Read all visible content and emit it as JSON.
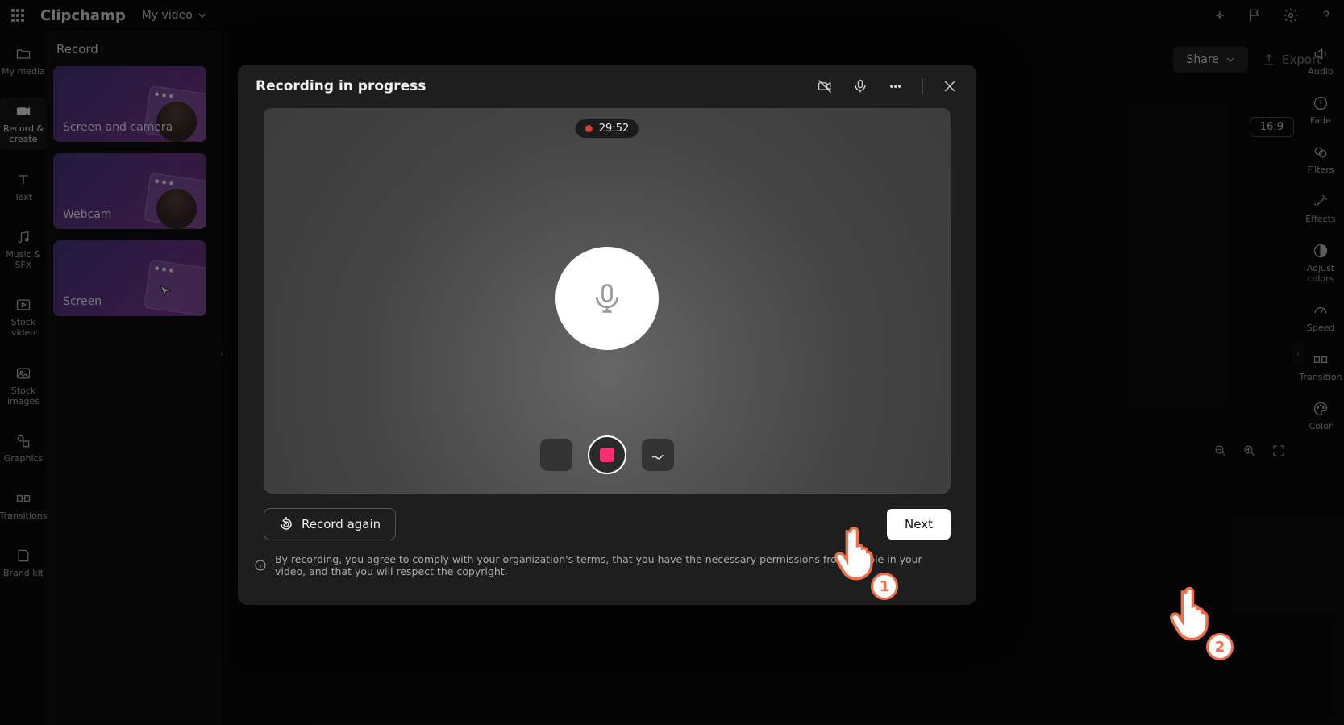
{
  "app": {
    "name": "Clipchamp",
    "project_name": "My video"
  },
  "topbar_icons": [
    "upgrade",
    "flag",
    "settings",
    "help"
  ],
  "actions": {
    "share": "Share",
    "export": "Export",
    "aspect": "16:9"
  },
  "left_sidebar": [
    {
      "id": "my-media",
      "label": "My media"
    },
    {
      "id": "record-create",
      "label": "Record & create",
      "active": true
    },
    {
      "id": "text",
      "label": "Text"
    },
    {
      "id": "music-sfx",
      "label": "Music & SFX"
    },
    {
      "id": "stock-video",
      "label": "Stock video"
    },
    {
      "id": "stock-images",
      "label": "Stock images"
    },
    {
      "id": "graphics",
      "label": "Graphics"
    },
    {
      "id": "transitions",
      "label": "Transitions"
    },
    {
      "id": "brand-kit",
      "label": "Brand kit"
    }
  ],
  "record_panel": {
    "title": "Record",
    "tiles": [
      {
        "id": "screen-camera",
        "label": "Screen and camera",
        "has_avatar": true,
        "has_window": true
      },
      {
        "id": "webcam",
        "label": "Webcam",
        "has_avatar": true,
        "has_window": true
      },
      {
        "id": "screen",
        "label": "Screen",
        "has_cursor": true,
        "has_window": true
      }
    ]
  },
  "right_sidebar": [
    {
      "id": "audio",
      "label": "Audio"
    },
    {
      "id": "fade",
      "label": "Fade"
    },
    {
      "id": "filters",
      "label": "Filters"
    },
    {
      "id": "effects",
      "label": "Effects"
    },
    {
      "id": "adjust-colors",
      "label": "Adjust colors"
    },
    {
      "id": "speed",
      "label": "Speed"
    },
    {
      "id": "transition",
      "label": "Transition"
    },
    {
      "id": "color",
      "label": "Color"
    }
  ],
  "modal": {
    "title": "Recording in progress",
    "elapsed": "29:52",
    "record_again": "Record again",
    "next": "Next",
    "disclaimer": "By recording, you agree to comply with your organization's terms, that you have the necessary permissions from people in your video, and that you will respect the copyright."
  },
  "callouts": {
    "step1": "1",
    "step2": "2"
  },
  "colors": {
    "accent_pink": "#ff2d6f",
    "callout_orange": "#f06e4a"
  }
}
